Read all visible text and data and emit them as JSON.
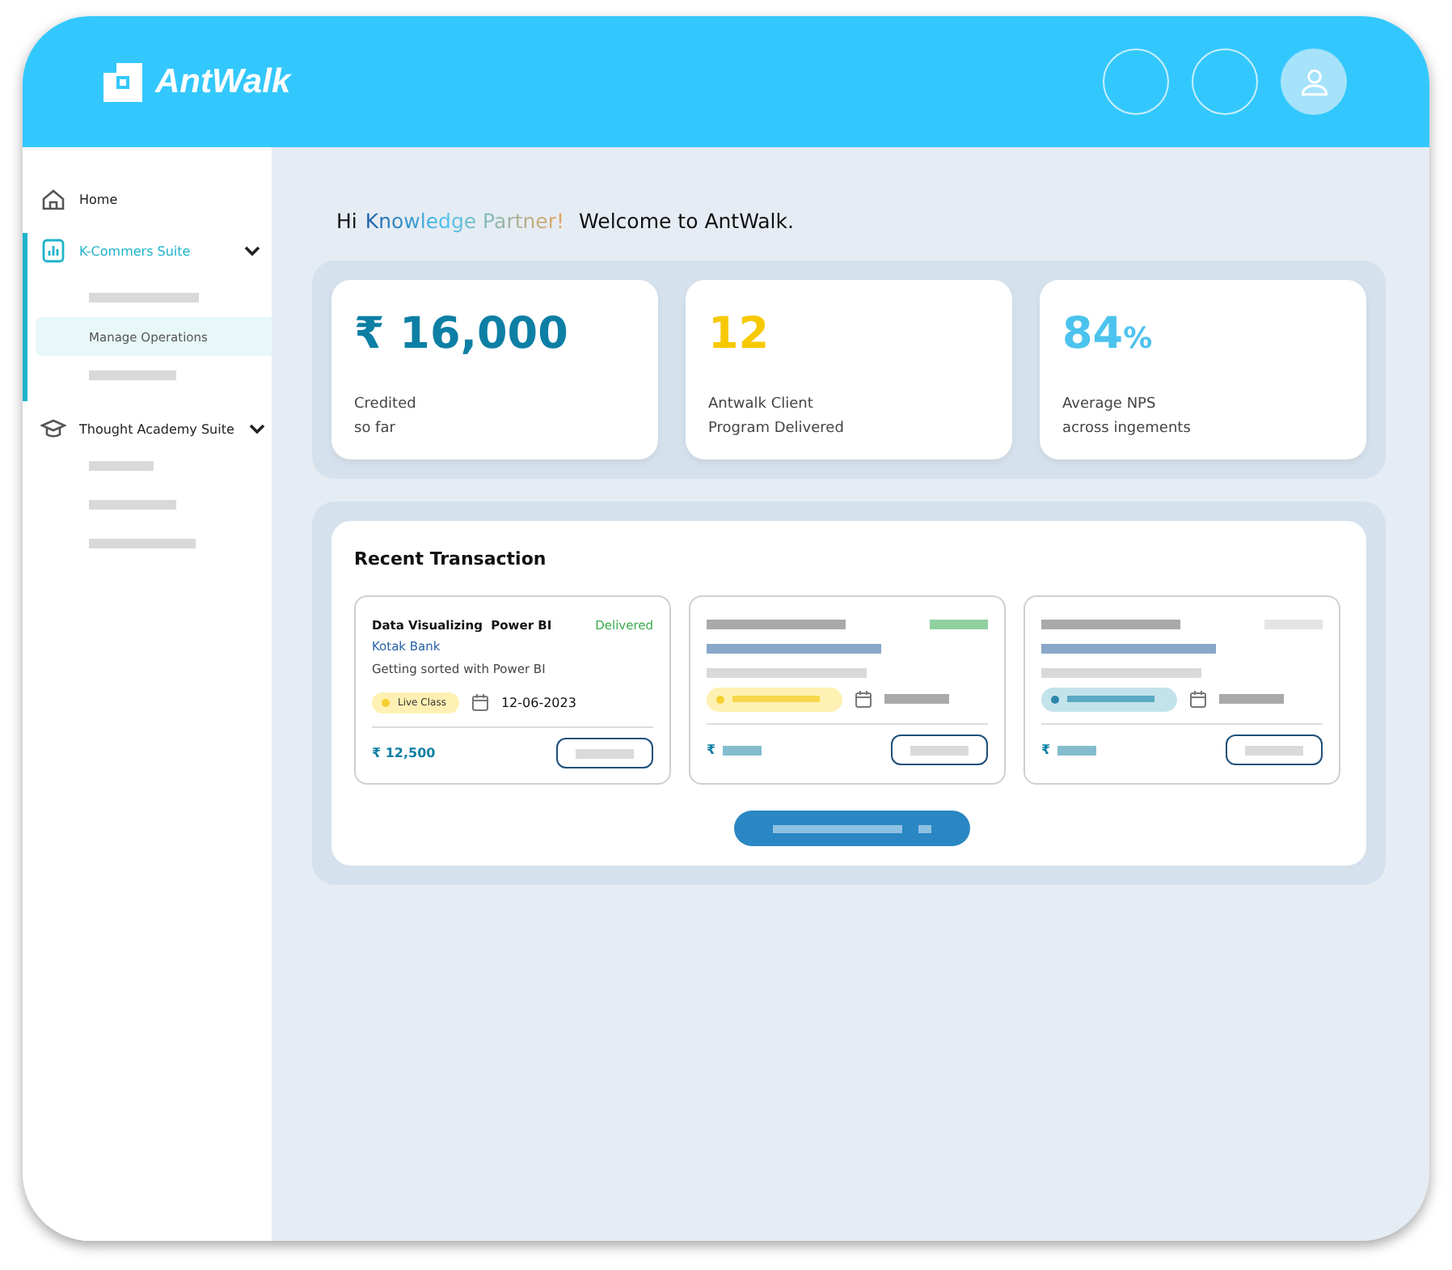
{
  "header": {
    "brand": "AntWalk"
  },
  "sidebar": {
    "items": [
      {
        "label": "Home",
        "kind": "home",
        "selected": false
      },
      {
        "label": "K-Commers Suite",
        "kind": "suite",
        "selected": true,
        "expanded": true,
        "children": [
          {
            "kind": "placeholder",
            "selected": false
          },
          {
            "kind": "link",
            "label": "Manage Operations",
            "selected": true
          },
          {
            "kind": "placeholder",
            "selected": false
          }
        ]
      },
      {
        "label": "Thought Academy Suite",
        "kind": "academy",
        "selected": false,
        "expanded": true,
        "children": [
          {
            "kind": "placeholder",
            "selected": false
          },
          {
            "kind": "placeholder",
            "selected": false
          },
          {
            "kind": "placeholder",
            "selected": false
          }
        ]
      }
    ]
  },
  "greeting": {
    "prefix": "Hi",
    "highlight": "Knowledge Partner!",
    "suffix": "Welcome to AntWalk."
  },
  "stats": [
    {
      "value": "₹ 16,000",
      "color": "#0d7fa5",
      "lines": [
        "Credited",
        "so far"
      ]
    },
    {
      "value": "12",
      "color": "#f7c900",
      "lines": [
        "Antwalk Client",
        "Program Delivered"
      ]
    },
    {
      "value": "84",
      "unit": "%",
      "color": "#4cc3ee",
      "lines": [
        "Average NPS",
        "across ingements"
      ]
    }
  ],
  "transactions": {
    "title": "Recent Transaction",
    "cards": [
      {
        "kind": "filled",
        "title": "Data Visualizing  Power BI",
        "status": "Delivered",
        "client": "Kotak Bank",
        "description": "Getting sorted with Power BI",
        "tag": "Live Class",
        "color": "#fff1b3",
        "date": "12-06-2023",
        "amount": "₹ 12,500"
      },
      {
        "kind": "skeleton",
        "delivered": true,
        "color": "#fff1b3",
        "currency": "₹"
      },
      {
        "kind": "skeleton",
        "delivered": false,
        "color": "#c3e3ec",
        "currency": "₹"
      }
    ]
  }
}
